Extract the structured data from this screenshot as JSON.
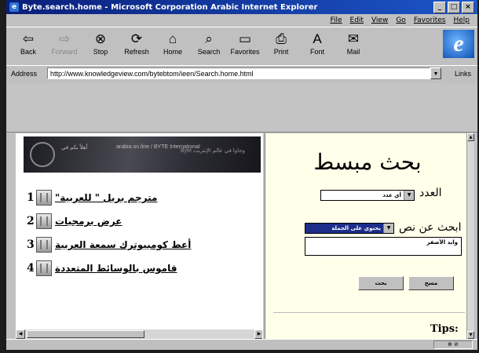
{
  "window": {
    "title": "Byte.search.home - Microsoft Corporation Arabic Internet Explorer",
    "controls": [
      "_",
      "□",
      "×"
    ]
  },
  "menubar": {
    "items": [
      "File",
      "Edit",
      "View",
      "Go",
      "Favorites",
      "Help"
    ]
  },
  "toolbar": {
    "buttons": [
      {
        "label": "Back",
        "icon": "back-arrow-icon",
        "glyph": "⇦"
      },
      {
        "label": "Forward",
        "icon": "forward-arrow-icon",
        "glyph": "⇨"
      },
      {
        "label": "Stop",
        "icon": "stop-icon",
        "glyph": "⊗"
      },
      {
        "label": "Refresh",
        "icon": "refresh-icon",
        "glyph": "⟳"
      },
      {
        "label": "Home",
        "icon": "home-icon",
        "glyph": "⌂"
      },
      {
        "label": "Search",
        "icon": "search-icon",
        "glyph": "⌕"
      },
      {
        "label": "Favorites",
        "icon": "favorites-icon",
        "glyph": "▭"
      },
      {
        "label": "Print",
        "icon": "print-icon",
        "glyph": "⎙"
      },
      {
        "label": "Font",
        "icon": "font-icon",
        "glyph": "A"
      },
      {
        "label": "Mail",
        "icon": "mail-icon",
        "glyph": "✉"
      }
    ],
    "logo_letter": "e"
  },
  "address": {
    "label": "Address",
    "url": "http://www.knowledgeview.com/bytebtom/ieen/Search.home.html",
    "links_label": "Links"
  },
  "left_frame": {
    "banner": {
      "text_1": "أهلاً بكم في",
      "text_2": "arabia.on.line / BYTE International",
      "text_3": "Byte وجاوا في عالم الإنترنت"
    },
    "items": [
      {
        "num": "1",
        "label": "مترجم بريل \" للعربية\""
      },
      {
        "num": "2",
        "label": "عرض برمجيات"
      },
      {
        "num": "3",
        "label": "أعط كومبيوترك سمعة العربية"
      },
      {
        "num": "4",
        "label": "قاموس بالوسائط المتعددة"
      }
    ]
  },
  "right_frame": {
    "title": "بحث مبسط",
    "count_label": "العدد",
    "count_value": "أي عدد",
    "search_label": "ابحث عن نص",
    "search_mode": "يحتوي على الجملة",
    "text_value": "وايد الأصفر",
    "clear_button": "مسح",
    "search_button": "بحث",
    "tips_label": "Tips:"
  },
  "status": {
    "text": "",
    "zone": "⊕ ⊘"
  }
}
